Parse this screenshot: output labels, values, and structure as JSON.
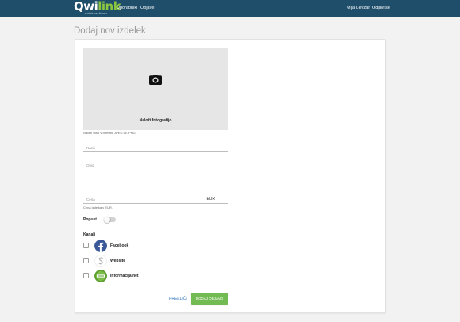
{
  "navbar": {
    "brand_name": "Qwilink",
    "brand_tagline": "quick webinar",
    "links": [
      "Uporabniki",
      "Objave"
    ],
    "user_name": "Mija Cevzar",
    "logout_label": "Odjavi se",
    "background_color": "#1f4e6b"
  },
  "page": {
    "title": "Dodaj nov izdelek"
  },
  "form": {
    "photo": {
      "icon": "camera-icon",
      "label": "Naloži fotografijo",
      "hint": "Naloži sliko v formatu JPEG oz. PNG."
    },
    "name_field": {
      "label": "Naziv",
      "value": ""
    },
    "description_field": {
      "label": "Opis",
      "value": ""
    },
    "price_field": {
      "label": "Cena",
      "suffix": "EUR",
      "hint": "Cena izdelka v EUR.",
      "value": ""
    },
    "discount": {
      "label": "Popust",
      "enabled": false
    },
    "channels": {
      "label": "Kanali",
      "items": [
        {
          "name": "Facebook",
          "icon": "facebook-icon",
          "checked": false
        },
        {
          "name": "Website",
          "icon": "website-icon",
          "checked": false
        },
        {
          "name": "Informacija.net",
          "icon": "informacija-net-icon",
          "checked": false
        }
      ]
    },
    "cancel_label": "PREKLIČI",
    "submit_label": "DODAJ OBJAVO",
    "accent_color": "#72bb53",
    "link_color": "#2b73b7"
  }
}
